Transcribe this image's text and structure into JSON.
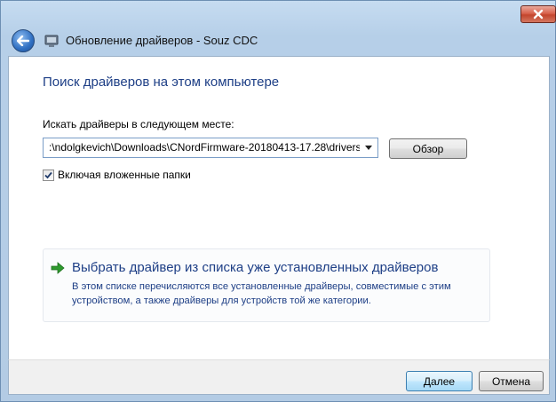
{
  "window": {
    "title": "Обновление драйверов - Souz CDC"
  },
  "page": {
    "heading": "Поиск драйверов на этом компьютере",
    "path_label": "Искать драйверы в следующем месте:",
    "path_value": ":\\ndolgkevich\\Downloads\\CNordFirmware-20180413-17.28\\drivers",
    "browse_label": "Обзор",
    "include_subfolders_label": "Включая вложенные папки",
    "include_subfolders_checked": true
  },
  "option": {
    "title": "Выбрать драйвер из списка уже установленных драйверов",
    "description": "В этом списке перечисляются все установленные драйверы, совместимые с этим устройством, а также драйверы для устройств той же категории."
  },
  "footer": {
    "next_label": "Далее",
    "cancel_label": "Отмена"
  },
  "icons": {
    "close": "close-icon",
    "back": "back-arrow-icon",
    "device": "device-icon",
    "dropdown": "chevron-down-icon",
    "checkmark": "checkmark-icon",
    "option_arrow": "green-arrow-icon"
  },
  "colors": {
    "link_blue": "#1e3f86",
    "close_red": "#c3452d",
    "arrow_green": "#2e9a2e"
  }
}
